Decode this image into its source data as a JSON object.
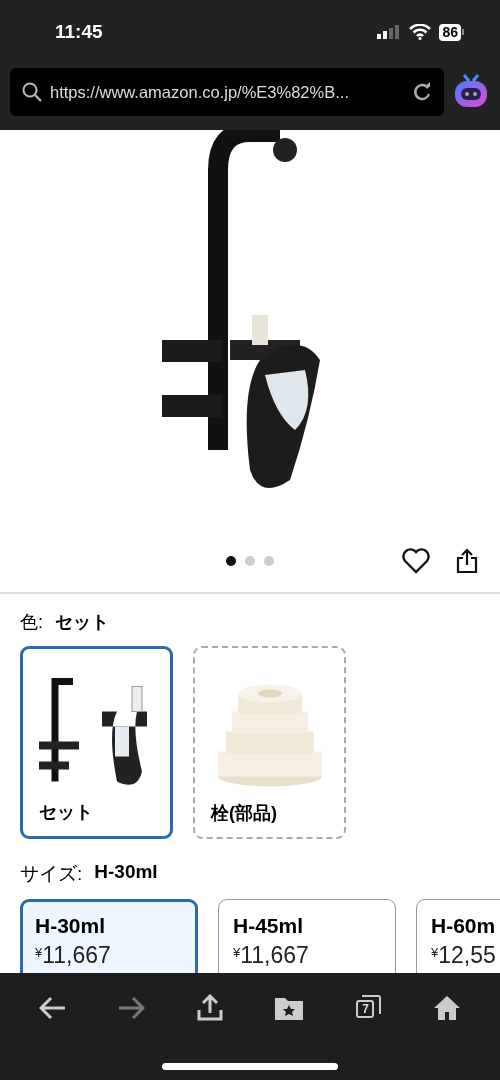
{
  "status_bar": {
    "time": "11:45",
    "battery": "86"
  },
  "address_bar": {
    "url": "https://www.amazon.co.jp/%E3%82%B..."
  },
  "gallery": {
    "dots": [
      {
        "selected": true
      },
      {
        "selected": false
      },
      {
        "selected": false
      }
    ]
  },
  "color_picker": {
    "label": "色:",
    "value": "セット",
    "options": [
      {
        "label": "セット",
        "kind": "stand",
        "selected": true
      },
      {
        "label": "栓(部品)",
        "kind": "plug",
        "selected": false
      }
    ]
  },
  "size_picker": {
    "label": "サイズ:",
    "value": "H-30ml",
    "options": [
      {
        "name": "H-30ml",
        "currency": "¥",
        "amount": "11,667",
        "selected": true
      },
      {
        "name": "H-45ml",
        "currency": "¥",
        "amount": "11,667",
        "selected": false
      },
      {
        "name": "H-60m",
        "currency": "¥",
        "amount": "12,55",
        "selected": false
      }
    ]
  },
  "toolbar": {
    "buttons": [
      {
        "kind": "back",
        "disabled": false
      },
      {
        "kind": "forward",
        "disabled": true
      },
      {
        "kind": "share",
        "disabled": false
      },
      {
        "kind": "bookmarks",
        "disabled": false
      },
      {
        "kind": "tabs",
        "count": "7",
        "disabled": false
      },
      {
        "kind": "home",
        "disabled": false
      }
    ]
  }
}
